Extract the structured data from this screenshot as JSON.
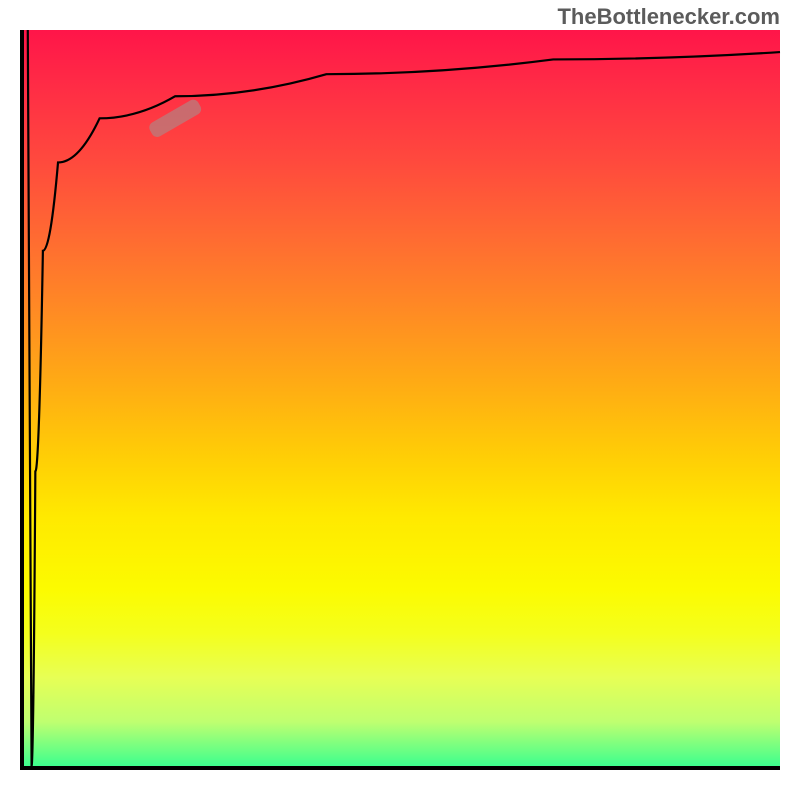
{
  "attribution": "TheBottlenecker.com",
  "chart_data": {
    "type": "line",
    "title": "",
    "xlabel": "",
    "ylabel": "",
    "xlim": [
      0,
      100
    ],
    "ylim": [
      0,
      100
    ],
    "series": [
      {
        "name": "curve",
        "points": [
          {
            "x": 0.5,
            "y": 100
          },
          {
            "x": 1.0,
            "y": 0
          },
          {
            "x": 1.5,
            "y": 40
          },
          {
            "x": 2.5,
            "y": 70
          },
          {
            "x": 4.5,
            "y": 82
          },
          {
            "x": 10,
            "y": 88
          },
          {
            "x": 20,
            "y": 91
          },
          {
            "x": 40,
            "y": 94
          },
          {
            "x": 70,
            "y": 96
          },
          {
            "x": 100,
            "y": 97
          }
        ]
      }
    ],
    "marker": {
      "x": 20,
      "y": 88,
      "angle": -30
    },
    "background_gradient": {
      "top": "#ff1549",
      "middle": "#ffe900",
      "bottom": "#3dff8e"
    }
  }
}
